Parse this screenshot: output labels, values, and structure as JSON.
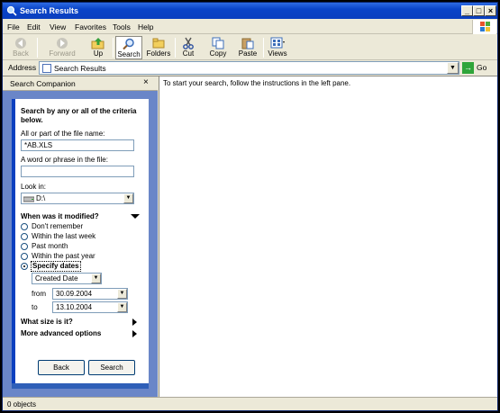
{
  "window": {
    "title": "Search Results"
  },
  "menu": [
    "File",
    "Edit",
    "View",
    "Favorites",
    "Tools",
    "Help"
  ],
  "toolbar": {
    "back": "Back",
    "forward": "Forward",
    "up": "Up",
    "search": "Search",
    "folders": "Folders",
    "cut": "Cut",
    "copy": "Copy",
    "paste": "Paste",
    "views": "Views"
  },
  "address": {
    "label": "Address",
    "value": "Search Results",
    "go": "Go"
  },
  "companion": {
    "title": "Search Companion",
    "close": "×",
    "heading": "Search by any or all of the criteria below.",
    "filename_label": "All or part of the file name:",
    "filename_value": "*AB.XLS",
    "phrase_label": "A word or phrase in the file:",
    "phrase_value": "",
    "lookin_label": "Look in:",
    "lookin_value": "D:\\",
    "modified_heading": "When was it modified?",
    "options": [
      "Don't remember",
      "Within the last week",
      "Past month",
      "Within the past year",
      "Specify dates"
    ],
    "selected_option": 4,
    "date_type": "Created Date",
    "from_label": "from",
    "from_value": "30.09.2004",
    "to_label": "to",
    "to_value": "13.10.2004",
    "size_heading": "What size is it?",
    "advanced_heading": "More advanced options",
    "back_button": "Back",
    "search_button": "Search"
  },
  "main": {
    "message": "To start your search, follow the instructions in the left pane."
  },
  "status": {
    "text": "0 objects"
  },
  "colors": {
    "titlebar": "#0a44c8",
    "pane_bg": "#6a86c8",
    "accent": "#0a3fbf"
  }
}
